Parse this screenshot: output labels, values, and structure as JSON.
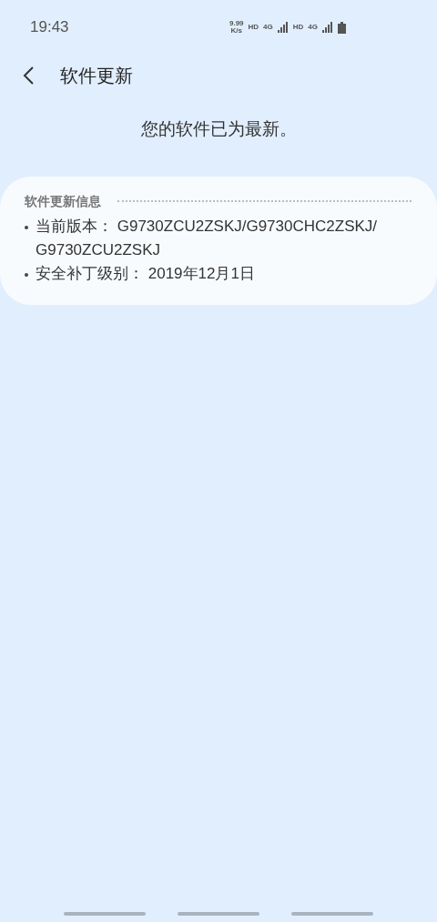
{
  "status_bar": {
    "time": "19:43",
    "net_speed": [
      "9.99",
      "K/s"
    ],
    "indicators": [
      "HD",
      "4G",
      "HD",
      "4G"
    ]
  },
  "header": {
    "title": "软件更新"
  },
  "message": "您的软件已为最新。",
  "info_card": {
    "heading": "软件更新信息",
    "items": [
      {
        "label": "当前版本：",
        "value": "G9730ZCU2ZSKJ/G9730CHC2ZSKJ/ G9730ZCU2ZSKJ"
      },
      {
        "label": "安全补丁级别：",
        "value": "2019年12月1日"
      }
    ]
  }
}
